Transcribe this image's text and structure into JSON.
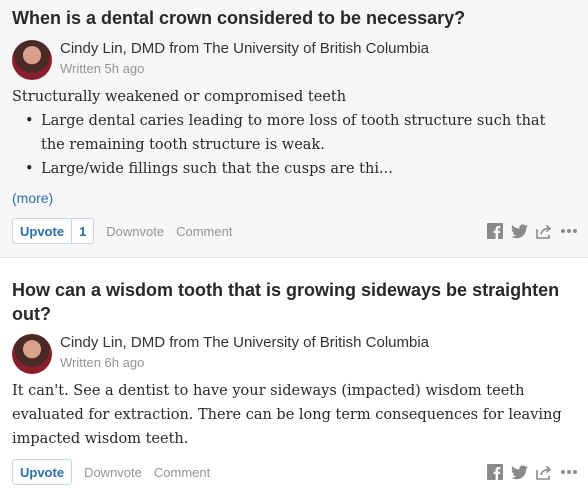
{
  "answers": [
    {
      "question": "When is a dental crown considered to be necessary?",
      "author": "Cindy Lin, DMD from The University of British Columbia",
      "written": "Written 5h ago",
      "intro": "Structurally weakened or compromised teeth",
      "bullets": [
        "Large dental caries leading to more loss of tooth structure such that the remaining tooth structure is weak.",
        "Large/wide fillings such that the cusps are thi..."
      ],
      "more": "(more)",
      "upvote_label": "Upvote",
      "upvote_count": "1",
      "downvote_label": "Downvote",
      "comment_label": "Comment"
    },
    {
      "question": "How can a wisdom tooth that is growing sideways be straighten out?",
      "author": "Cindy Lin, DMD from The University of British Columbia",
      "written": "Written 6h ago",
      "text": "It can't. See a dentist to have your sideways (impacted) wisdom teeth evaluated for extraction. There can be long term consequences for leaving impacted wisdom teeth.",
      "upvote_label": "Upvote",
      "downvote_label": "Downvote",
      "comment_label": "Comment"
    }
  ],
  "icons": [
    "facebook-icon",
    "twitter-icon",
    "share-icon",
    "more-options-icon"
  ],
  "colors": {
    "link": "#2b6dad",
    "muted": "#949494",
    "title": "#282829"
  }
}
